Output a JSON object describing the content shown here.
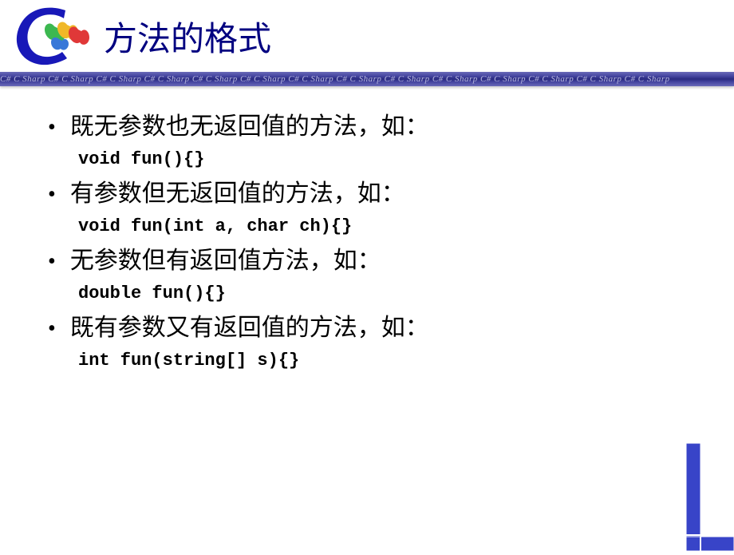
{
  "header": {
    "title": "方法的格式",
    "divider_repeat": "C# C Sharp  "
  },
  "content": {
    "items": [
      {
        "text": "既无参数也无返回值的方法，如：",
        "code": "void fun(){}"
      },
      {
        "text": "有参数但无返回值的方法，如：",
        "code": "void fun(int a, char ch){}"
      },
      {
        "text": "无参数但有返回值方法，如：",
        "code": "double fun(){}"
      },
      {
        "text": "既有参数又有返回值的方法，如：",
        "code": "int fun(string[] s){}"
      }
    ]
  }
}
